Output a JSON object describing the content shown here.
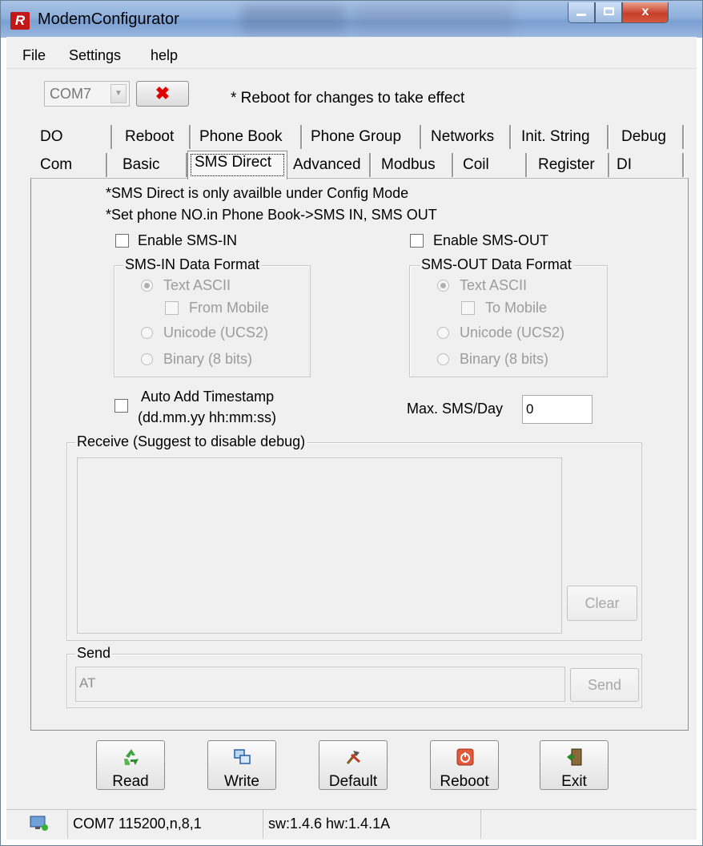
{
  "window": {
    "title": "ModemConfigurator",
    "logo_letter": "R",
    "close_label": "x"
  },
  "menu": {
    "items": [
      "File",
      "Settings",
      "help"
    ]
  },
  "toolbar": {
    "port": "COM7",
    "disconnect_label": "✖",
    "note": "* Reboot for changes to take effect"
  },
  "tabs": {
    "row_back": [
      "DO",
      "Reboot",
      "Phone Book",
      "Phone Group",
      "Networks",
      "Init. String",
      "Debug"
    ],
    "row_front": [
      "Com",
      "Basic",
      "SMS Direct",
      "Advanced",
      "Modbus",
      "Coil",
      "Register",
      "DI"
    ],
    "active": "SMS Direct"
  },
  "sms": {
    "notice1": "*SMS Direct is only availble under Config Mode",
    "notice2": "*Set phone NO.in Phone Book->SMS IN, SMS OUT",
    "enable_in": "Enable SMS-IN",
    "enable_out": "Enable SMS-OUT",
    "in_group": "SMS-IN Data Format",
    "out_group": "SMS-OUT Data Format",
    "text_ascii": "Text ASCII",
    "from_mobile": "From Mobile",
    "to_mobile": "To Mobile",
    "unicode": "Unicode (UCS2)",
    "binary": "Binary (8 bits)",
    "timestamp_line1": "Auto Add Timestamp",
    "timestamp_line2": "(dd.mm.yy hh:mm:ss)",
    "max_label": "Max.  SMS/Day",
    "max_value": "0"
  },
  "receive": {
    "label": "Receive (Suggest to disable debug)",
    "clear_label": "Clear"
  },
  "send": {
    "label": "Send",
    "value": "AT",
    "button_label": "Send"
  },
  "actions": {
    "read": "Read",
    "write": "Write",
    "default": "Default",
    "reboot": "Reboot",
    "exit": "Exit"
  },
  "status": {
    "port_info": "COM7 115200,n,8,1",
    "version": "sw:1.4.6 hw:1.4.1A"
  }
}
